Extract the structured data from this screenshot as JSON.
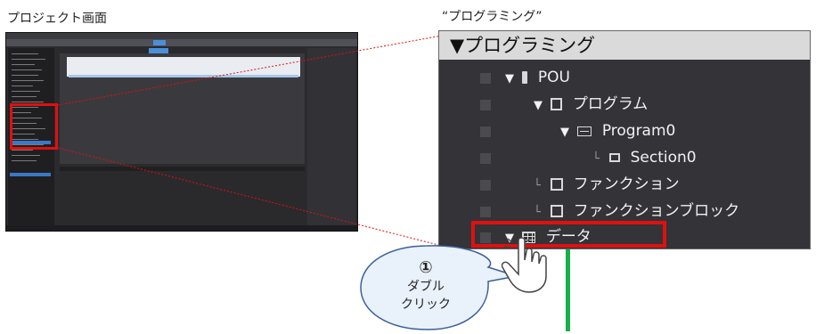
{
  "captions": {
    "left": "プロジェクト画面",
    "right": "“プログラミング”"
  },
  "tree": {
    "header_label": "▼プログラミング",
    "items": [
      {
        "label": "POU",
        "icon": "pou-icon"
      },
      {
        "label": "プログラム",
        "icon": "program-icon"
      },
      {
        "label": "Program0",
        "icon": "ladder-icon"
      },
      {
        "label": "Section0",
        "icon": "section-icon"
      },
      {
        "label": "ファンクション",
        "icon": "function-icon"
      },
      {
        "label": "ファンクションブロック",
        "icon": "function-block-icon"
      },
      {
        "label": "データ",
        "icon": "data-grid-icon"
      }
    ]
  },
  "callout": {
    "step": "①",
    "line1": "ダブル",
    "line2": "クリック"
  },
  "colors": {
    "highlight": "#e01010",
    "panel_bg": "#333338",
    "green_line": "#16b04a"
  }
}
